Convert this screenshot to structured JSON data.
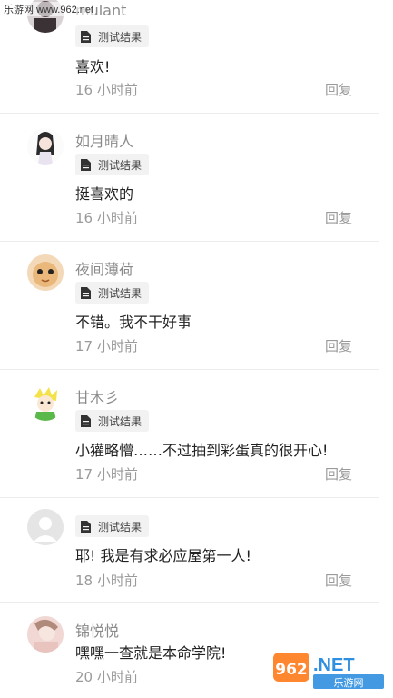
{
  "watermark_top": "乐游网 www.962.net",
  "comments": [
    {
      "username": "mulant",
      "tag": "测试结果",
      "text": "喜欢!",
      "time": "16 小时前",
      "reply": "回复"
    },
    {
      "username": "如月晴人",
      "tag": "测试结果",
      "text": "挺喜欢的",
      "time": "16 小时前",
      "reply": "回复"
    },
    {
      "username": "夜间薄荷",
      "tag": "测试结果",
      "text": "不错。我不干好事",
      "time": "17 小时前",
      "reply": "回复"
    },
    {
      "username": "甘木彡",
      "tag": "测试结果",
      "text": "小獾略懵……不过抽到彩蛋真的很开心!",
      "time": "17 小时前",
      "reply": "回复"
    },
    {
      "username": "",
      "tag": "测试结果",
      "text": "耶! 我是有求必应屋第一人!",
      "time": "18 小时前",
      "reply": "回复"
    },
    {
      "username": "锦悦悦",
      "text": "嘿嘿一查就是本命学院!",
      "time": "20 小时前"
    }
  ],
  "logo_watermark": {
    "number": "962",
    "suffix": ".NET",
    "sub": "乐游网"
  },
  "colors": {
    "muted": "#9a9a9a",
    "tag_bg": "#f2f2f2",
    "divider": "#ececec"
  }
}
